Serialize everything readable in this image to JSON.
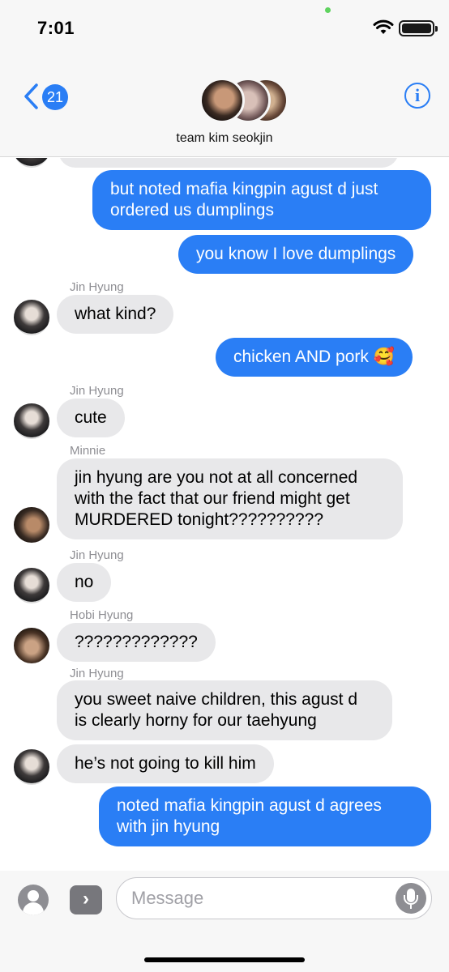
{
  "status_bar": {
    "time": "7:01"
  },
  "header": {
    "back_badge": "21",
    "group_name": "team kim seokjin",
    "info_label": "i"
  },
  "messages": [
    {
      "direction": "outgoing",
      "text": "but noted mafia kingpin agust d just ordered us dumplings"
    },
    {
      "direction": "outgoing",
      "text": "you know I love dumplings"
    },
    {
      "direction": "incoming",
      "sender": "Jin Hyung",
      "text": "what kind?"
    },
    {
      "direction": "outgoing",
      "text": "chicken AND pork 🥰"
    },
    {
      "direction": "incoming",
      "sender": "Jin Hyung",
      "text": "cute"
    },
    {
      "direction": "incoming",
      "sender": "Minnie",
      "text": "jin hyung are you not at all concerned with the fact that our friend might get MURDERED tonight??????????"
    },
    {
      "direction": "incoming",
      "sender": "Jin Hyung",
      "text": "no"
    },
    {
      "direction": "incoming",
      "sender": "Hobi Hyung",
      "text": "?????????????"
    },
    {
      "direction": "incoming",
      "sender": "Jin Hyung",
      "text": "you sweet naive children, this agust d is clearly horny for our taehyung"
    },
    {
      "direction": "incoming",
      "text": "he’s not going to kill him"
    },
    {
      "direction": "outgoing",
      "text": "noted mafia kingpin agust d agrees with jin hyung"
    }
  ],
  "composer": {
    "placeholder": "Message"
  },
  "icons": {
    "back": "chevron-left-icon",
    "info": "info-icon",
    "camera": "contact-icon",
    "apps": "apps-arrow-icon",
    "mic": "mic-icon",
    "wifi": "wifi-icon",
    "battery": "battery-icon"
  },
  "colors": {
    "accent": "#2a7ef5",
    "incoming_bubble": "#e8e8ea",
    "header_bg": "#f7f7f7"
  }
}
